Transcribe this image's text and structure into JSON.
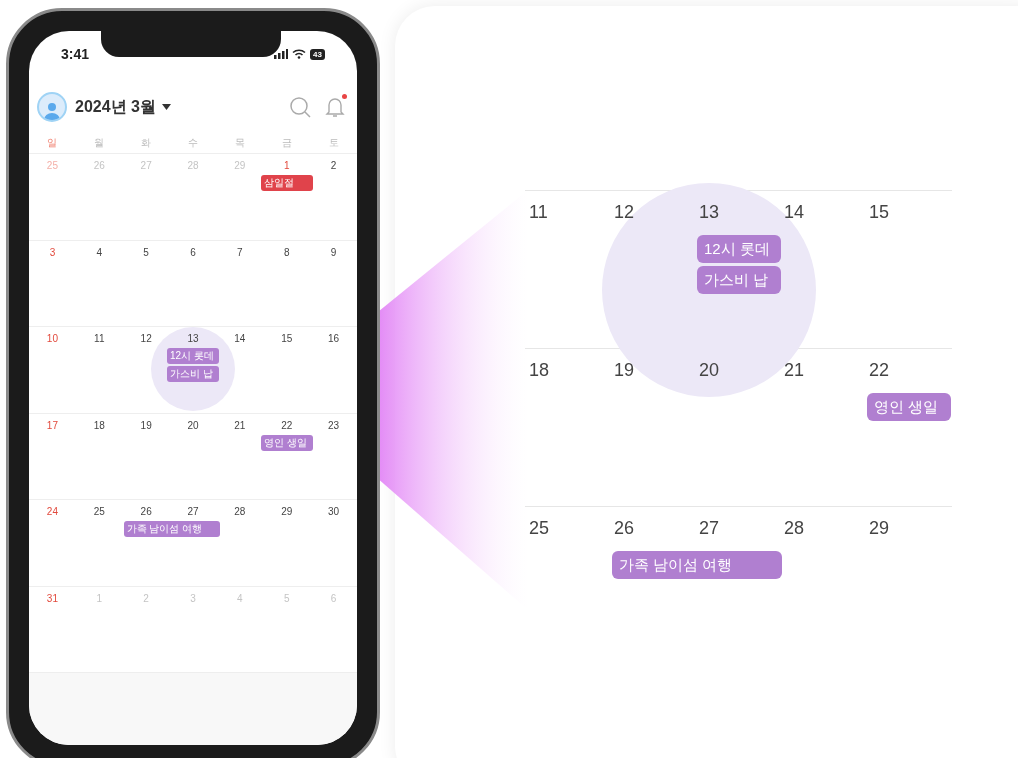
{
  "status_bar": {
    "time": "3:41",
    "battery": "43"
  },
  "header": {
    "title": "2024년 3월",
    "has_notification": true
  },
  "weekdays": [
    {
      "label": "일",
      "holiday": true
    },
    {
      "label": "월",
      "holiday": false
    },
    {
      "label": "화",
      "holiday": false
    },
    {
      "label": "수",
      "holiday": false
    },
    {
      "label": "목",
      "holiday": false
    },
    {
      "label": "금",
      "holiday": false
    },
    {
      "label": "토",
      "holiday": false
    }
  ],
  "weeks": [
    {
      "days": [
        {
          "label": "25",
          "holiday": true,
          "outside": true
        },
        {
          "label": "26",
          "holiday": false,
          "outside": true
        },
        {
          "label": "27",
          "holiday": false,
          "outside": true
        },
        {
          "label": "28",
          "holiday": false,
          "outside": true
        },
        {
          "label": "29",
          "holiday": false,
          "outside": true
        },
        {
          "label": "1",
          "holiday": true,
          "outside": false,
          "events": [
            {
              "label": "삼일절",
              "color": "#e0434b",
              "kind": "single"
            }
          ]
        },
        {
          "label": "2",
          "holiday": false,
          "outside": false
        }
      ]
    },
    {
      "days": [
        {
          "label": "3",
          "holiday": true,
          "outside": false
        },
        {
          "label": "4",
          "holiday": false,
          "outside": false
        },
        {
          "label": "5",
          "holiday": false,
          "outside": false
        },
        {
          "label": "6",
          "holiday": false,
          "outside": false
        },
        {
          "label": "7",
          "holiday": false,
          "outside": false
        },
        {
          "label": "8",
          "holiday": false,
          "outside": false
        },
        {
          "label": "9",
          "holiday": false,
          "outside": false
        }
      ]
    },
    {
      "days": [
        {
          "label": "10",
          "holiday": true,
          "outside": false
        },
        {
          "label": "11",
          "holiday": false,
          "outside": false
        },
        {
          "label": "12",
          "holiday": false,
          "outside": false
        },
        {
          "label": "13",
          "holiday": false,
          "outside": false,
          "highlighted": true,
          "events": [
            {
              "label": "12시 롯데",
              "color": "#b07fd0",
              "kind": "single"
            },
            {
              "label": "가스비 납",
              "color": "#b07fd0",
              "kind": "single"
            }
          ]
        },
        {
          "label": "14",
          "holiday": false,
          "outside": false
        },
        {
          "label": "15",
          "holiday": false,
          "outside": false
        },
        {
          "label": "16",
          "holiday": false,
          "outside": false
        }
      ]
    },
    {
      "days": [
        {
          "label": "17",
          "holiday": true,
          "outside": false
        },
        {
          "label": "18",
          "holiday": false,
          "outside": false
        },
        {
          "label": "19",
          "holiday": false,
          "outside": false
        },
        {
          "label": "20",
          "holiday": false,
          "outside": false
        },
        {
          "label": "21",
          "holiday": false,
          "outside": false
        },
        {
          "label": "22",
          "holiday": false,
          "outside": false,
          "events": [
            {
              "label": "영인 생일",
              "color": "#b07fd0",
              "kind": "single"
            }
          ]
        },
        {
          "label": "23",
          "holiday": false,
          "outside": false
        }
      ]
    },
    {
      "days": [
        {
          "label": "24",
          "holiday": true,
          "outside": false
        },
        {
          "label": "25",
          "holiday": false,
          "outside": false
        },
        {
          "label": "26",
          "holiday": false,
          "outside": false,
          "events": [
            {
              "label": "가족 남이섬 여행",
              "color": "#b07fd0",
              "kind": "two-day"
            }
          ]
        },
        {
          "label": "27",
          "holiday": false,
          "outside": false
        },
        {
          "label": "28",
          "holiday": false,
          "outside": false
        },
        {
          "label": "29",
          "holiday": false,
          "outside": false
        },
        {
          "label": "30",
          "holiday": false,
          "outside": false
        }
      ]
    },
    {
      "days": [
        {
          "label": "31",
          "holiday": true,
          "outside": false
        },
        {
          "label": "1",
          "holiday": false,
          "outside": true
        },
        {
          "label": "2",
          "holiday": false,
          "outside": true
        },
        {
          "label": "3",
          "holiday": false,
          "outside": true
        },
        {
          "label": "4",
          "holiday": false,
          "outside": true
        },
        {
          "label": "5",
          "holiday": false,
          "outside": true
        },
        {
          "label": "6",
          "holiday": false,
          "outside": true
        }
      ]
    }
  ],
  "zoom": {
    "weeks": [
      {
        "days": [
          {
            "label": "11"
          },
          {
            "label": "12"
          },
          {
            "label": "13",
            "highlighted": true,
            "events": [
              {
                "label": "12시 롯데",
                "color": "#b07fd0",
                "kind": "single"
              },
              {
                "label": "가스비 납",
                "color": "#b07fd0",
                "kind": "single"
              }
            ]
          },
          {
            "label": "14"
          },
          {
            "label": "15"
          }
        ]
      },
      {
        "days": [
          {
            "label": "18"
          },
          {
            "label": "19"
          },
          {
            "label": "20"
          },
          {
            "label": "21"
          },
          {
            "label": "22",
            "events": [
              {
                "label": "영인 생일",
                "color": "#b07fd0",
                "kind": "single"
              }
            ]
          }
        ]
      },
      {
        "days": [
          {
            "label": "25"
          },
          {
            "label": "26",
            "events": [
              {
                "label": "가족 남이섬 여행",
                "color": "#b07fd0",
                "kind": "two-day"
              }
            ]
          },
          {
            "label": "27"
          },
          {
            "label": "28"
          },
          {
            "label": "29"
          }
        ]
      }
    ]
  }
}
